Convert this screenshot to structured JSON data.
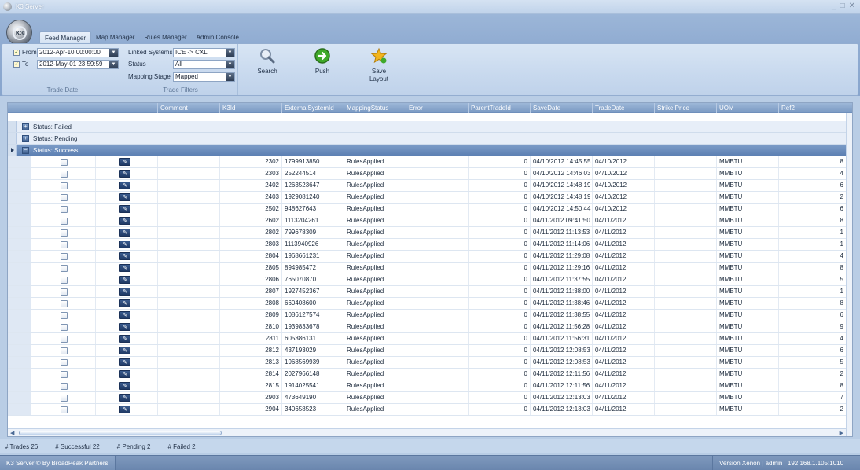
{
  "window": {
    "title": "K3 Server",
    "controls": [
      "_",
      "□",
      "✕"
    ]
  },
  "orb": {
    "label": "K3"
  },
  "tabs": [
    "Feed Manager",
    "Map Manager",
    "Rules Manager",
    "Admin Console"
  ],
  "active_tab": "Feed Manager",
  "trade_date": {
    "from_label": "From",
    "from_value": "2012-Apr-10 00:00:00",
    "to_label": "To",
    "to_value": "2012-May-01 23:59:59",
    "group_label": "Trade Date"
  },
  "trade_filters": {
    "linked_label": "Linked Systems",
    "linked_value": "ICE -> CXL",
    "status_label": "Status",
    "status_value": "All",
    "stage_label": "Mapping Stage",
    "stage_value": "Mapped",
    "group_label": "Trade Filters"
  },
  "actions": {
    "search": "Search",
    "push": "Push",
    "save_line1": "Save",
    "save_line2": "Layout"
  },
  "grid": {
    "columns": [
      "Comment",
      "K3Id",
      "ExternalSystemId",
      "MappingStatus",
      "Error",
      "ParentTradeId",
      "SaveDate",
      "TradeDate",
      "Strike Price",
      "UOM",
      "Ref2"
    ],
    "groups": [
      "Status: Failed",
      "Status: Pending",
      "Status: Success"
    ],
    "rows": [
      {
        "k3id": "2302",
        "ext": "1799913850",
        "status": "RulesApplied",
        "parent": "0",
        "save": "04/10/2012 14:45:55",
        "trade": "04/10/2012",
        "uom": "MMBTU",
        "ref2": "8"
      },
      {
        "k3id": "2303",
        "ext": "252244514",
        "status": "RulesApplied",
        "parent": "0",
        "save": "04/10/2012 14:46:03",
        "trade": "04/10/2012",
        "uom": "MMBTU",
        "ref2": "4"
      },
      {
        "k3id": "2402",
        "ext": "1263523647",
        "status": "RulesApplied",
        "parent": "0",
        "save": "04/10/2012 14:48:19",
        "trade": "04/10/2012",
        "uom": "MMBTU",
        "ref2": "6"
      },
      {
        "k3id": "2403",
        "ext": "1929081240",
        "status": "RulesApplied",
        "parent": "0",
        "save": "04/10/2012 14:48:19",
        "trade": "04/10/2012",
        "uom": "MMBTU",
        "ref2": "2"
      },
      {
        "k3id": "2502",
        "ext": "948627643",
        "status": "RulesApplied",
        "parent": "0",
        "save": "04/10/2012 14:50:44",
        "trade": "04/10/2012",
        "uom": "MMBTU",
        "ref2": "6"
      },
      {
        "k3id": "2602",
        "ext": "1113204261",
        "status": "RulesApplied",
        "parent": "0",
        "save": "04/11/2012 09:41:50",
        "trade": "04/11/2012",
        "uom": "MMBTU",
        "ref2": "8"
      },
      {
        "k3id": "2802",
        "ext": "799678309",
        "status": "RulesApplied",
        "parent": "0",
        "save": "04/11/2012 11:13:53",
        "trade": "04/11/2012",
        "uom": "MMBTU",
        "ref2": "1"
      },
      {
        "k3id": "2803",
        "ext": "1113940926",
        "status": "RulesApplied",
        "parent": "0",
        "save": "04/11/2012 11:14:06",
        "trade": "04/11/2012",
        "uom": "MMBTU",
        "ref2": "1"
      },
      {
        "k3id": "2804",
        "ext": "1968661231",
        "status": "RulesApplied",
        "parent": "0",
        "save": "04/11/2012 11:29:08",
        "trade": "04/11/2012",
        "uom": "MMBTU",
        "ref2": "4"
      },
      {
        "k3id": "2805",
        "ext": "894985472",
        "status": "RulesApplied",
        "parent": "0",
        "save": "04/11/2012 11:29:16",
        "trade": "04/11/2012",
        "uom": "MMBTU",
        "ref2": "8"
      },
      {
        "k3id": "2806",
        "ext": "765070870",
        "status": "RulesApplied",
        "parent": "0",
        "save": "04/11/2012 11:37:55",
        "trade": "04/11/2012",
        "uom": "MMBTU",
        "ref2": "5"
      },
      {
        "k3id": "2807",
        "ext": "1927452367",
        "status": "RulesApplied",
        "parent": "0",
        "save": "04/11/2012 11:38:00",
        "trade": "04/11/2012",
        "uom": "MMBTU",
        "ref2": "1"
      },
      {
        "k3id": "2808",
        "ext": "660408600",
        "status": "RulesApplied",
        "parent": "0",
        "save": "04/11/2012 11:38:46",
        "trade": "04/11/2012",
        "uom": "MMBTU",
        "ref2": "8"
      },
      {
        "k3id": "2809",
        "ext": "1086127574",
        "status": "RulesApplied",
        "parent": "0",
        "save": "04/11/2012 11:38:55",
        "trade": "04/11/2012",
        "uom": "MMBTU",
        "ref2": "6"
      },
      {
        "k3id": "2810",
        "ext": "1939833678",
        "status": "RulesApplied",
        "parent": "0",
        "save": "04/11/2012 11:56:28",
        "trade": "04/11/2012",
        "uom": "MMBTU",
        "ref2": "9"
      },
      {
        "k3id": "2811",
        "ext": "605386131",
        "status": "RulesApplied",
        "parent": "0",
        "save": "04/11/2012 11:56:31",
        "trade": "04/11/2012",
        "uom": "MMBTU",
        "ref2": "4"
      },
      {
        "k3id": "2812",
        "ext": "437193029",
        "status": "RulesApplied",
        "parent": "0",
        "save": "04/11/2012 12:08:53",
        "trade": "04/11/2012",
        "uom": "MMBTU",
        "ref2": "6"
      },
      {
        "k3id": "2813",
        "ext": "1968569939",
        "status": "RulesApplied",
        "parent": "0",
        "save": "04/11/2012 12:08:53",
        "trade": "04/11/2012",
        "uom": "MMBTU",
        "ref2": "5"
      },
      {
        "k3id": "2814",
        "ext": "2027966148",
        "status": "RulesApplied",
        "parent": "0",
        "save": "04/11/2012 12:11:56",
        "trade": "04/11/2012",
        "uom": "MMBTU",
        "ref2": "2"
      },
      {
        "k3id": "2815",
        "ext": "1914025541",
        "status": "RulesApplied",
        "parent": "0",
        "save": "04/11/2012 12:11:56",
        "trade": "04/11/2012",
        "uom": "MMBTU",
        "ref2": "8"
      },
      {
        "k3id": "2903",
        "ext": "473649190",
        "status": "RulesApplied",
        "parent": "0",
        "save": "04/11/2012 12:13:03",
        "trade": "04/11/2012",
        "uom": "MMBTU",
        "ref2": "7"
      },
      {
        "k3id": "2904",
        "ext": "340658523",
        "status": "RulesApplied",
        "parent": "0",
        "save": "04/11/2012 12:13:03",
        "trade": "04/11/2012",
        "uom": "MMBTU",
        "ref2": "2"
      }
    ]
  },
  "summary": {
    "trades": "# Trades 26",
    "successful": "# Successful 22",
    "pending": "# Pending 2",
    "failed": "# Failed 2"
  },
  "statusbar": {
    "left": "K3 Server © By BroadPeak Partners",
    "right": "Version Xenon | admin | 192.168.1.105:1010"
  },
  "colors": {
    "accent": "#7b9ac3",
    "ribbon": "#c8d9ee",
    "push_icon": "#3fa92a",
    "star_icon": "#f2b51d"
  }
}
